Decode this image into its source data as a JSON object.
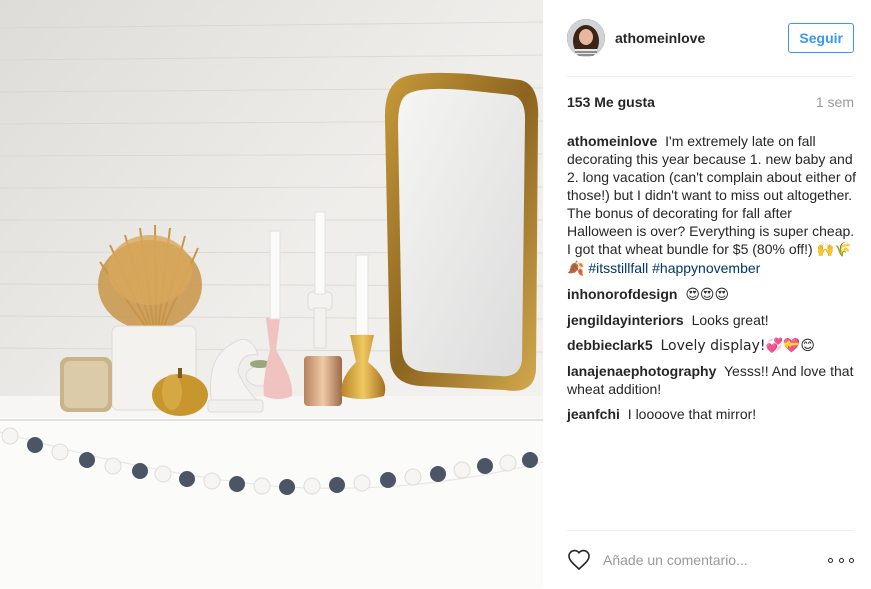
{
  "post": {
    "author": {
      "username": "athomeinlove"
    },
    "follow_label": "Seguir",
    "likes_text": "153 Me gusta",
    "time_ago": "1 sem",
    "caption": {
      "user": "athomeinlove",
      "text": "I'm extremely late on fall decorating this year because 1. new baby and 2. long vacation (can't complain about either of those!) but I didn't want to miss out altogether. The bonus of decorating for fall after Halloween is over? Everything is super cheap. I got that wheat bundle for $5 (80% off!)",
      "emojis": "🙌🌾🍂",
      "hashtags": [
        "#itsstillfall",
        "#happynovember"
      ]
    },
    "comments": [
      {
        "user": "inhonorofdesign",
        "text": "😍😍😍"
      },
      {
        "user": "jengildayinteriors",
        "text": "Looks great!"
      },
      {
        "user": "debbieclark5",
        "text": "Lovely display!💞💝😊"
      },
      {
        "user": "lanajenaephotography",
        "text": "Yesss!! And love that wheat addition!"
      },
      {
        "user": "jeanfchi",
        "text": "I loooove that mirror!"
      }
    ],
    "add_comment_placeholder": "Añade un comentario...",
    "icons": {
      "like": "heart-icon",
      "more": "more-options-icon"
    },
    "colors": {
      "link": "#3897f0",
      "hashtag": "#003569",
      "muted": "#999999"
    }
  }
}
